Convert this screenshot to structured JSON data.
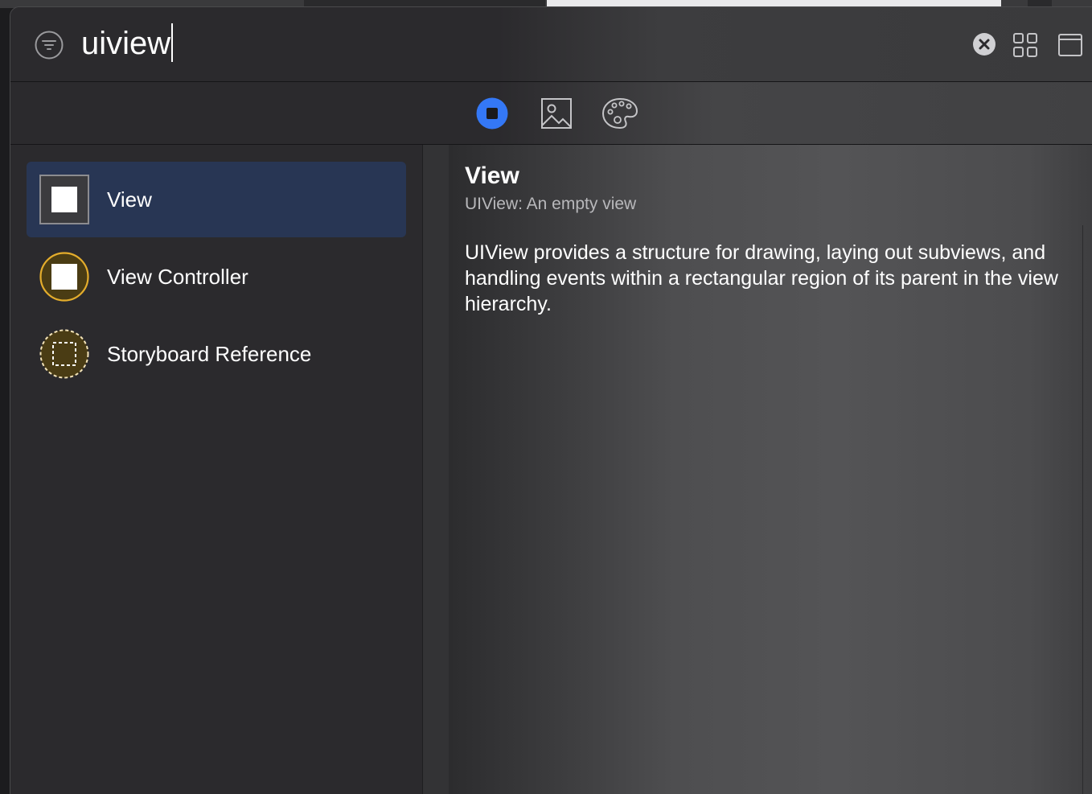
{
  "search": {
    "value": "uiview",
    "placeholder": ""
  },
  "header": {
    "filter_icon": "filter-icon",
    "clear_icon": "clear-circle-icon",
    "grid_icon": "grid-view-icon",
    "window_icon": "window-icon"
  },
  "segments": [
    {
      "name": "objects",
      "icon": "objects-icon",
      "selected": true,
      "color": "#3478f6"
    },
    {
      "name": "media",
      "icon": "image-icon",
      "selected": false
    },
    {
      "name": "colors",
      "icon": "palette-icon",
      "selected": false
    }
  ],
  "list": {
    "items": [
      {
        "label": "View",
        "icon": "view-icon",
        "selected": true
      },
      {
        "label": "View Controller",
        "icon": "view-controller-icon",
        "selected": false,
        "color": "#e4ad2c"
      },
      {
        "label": "Storyboard Reference",
        "icon": "storyboard-reference-icon",
        "selected": false
      }
    ]
  },
  "detail": {
    "title": "View",
    "subtitle": "UIView: An empty view",
    "body": "UIView provides a structure for drawing, laying out subviews, and handling events within a rectangular region of its parent in the view hierarchy."
  },
  "colors": {
    "accent": "#3478f6",
    "selection": "#283654",
    "vc_yellow": "#e4ad2c"
  }
}
